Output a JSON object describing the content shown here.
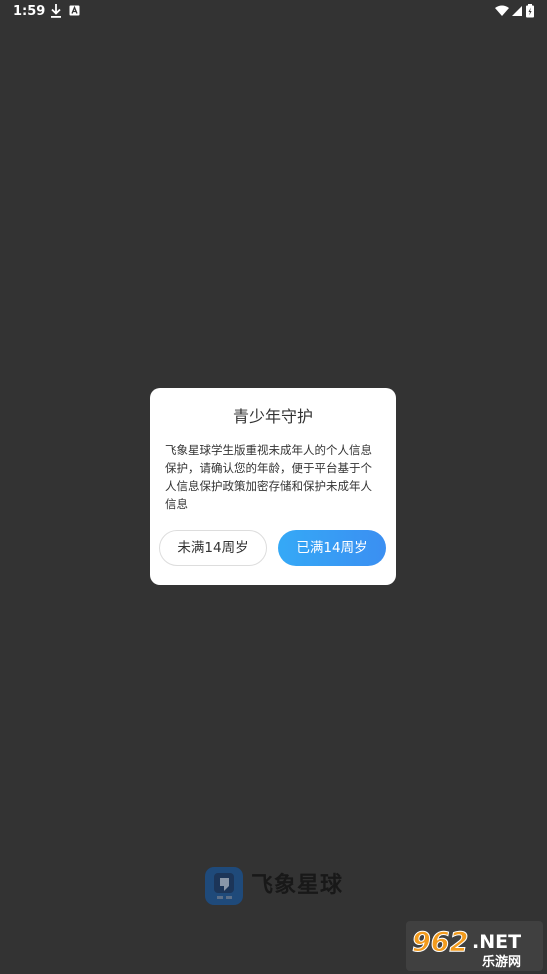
{
  "status_bar": {
    "time": "1:59",
    "left_icons": [
      "download-icon",
      "a-badge-icon"
    ],
    "right_icons": [
      "wifi-icon",
      "signal-icon",
      "battery-icon"
    ]
  },
  "dialog": {
    "title": "青少年守护",
    "body": "飞象星球学生版重视未成年人的个人信息保护，请确认您的年龄，便于平台基于个人信息保护政策加密存储和保护未成年人信息",
    "under_14_label": "未满14周岁",
    "over_14_label": "已满14周岁",
    "accent_color": "#3b9ff4"
  },
  "brand": {
    "name": "飞象星球"
  },
  "watermark": {
    "number": "962",
    "suffix": ".NET",
    "subtitle": "乐游网"
  }
}
